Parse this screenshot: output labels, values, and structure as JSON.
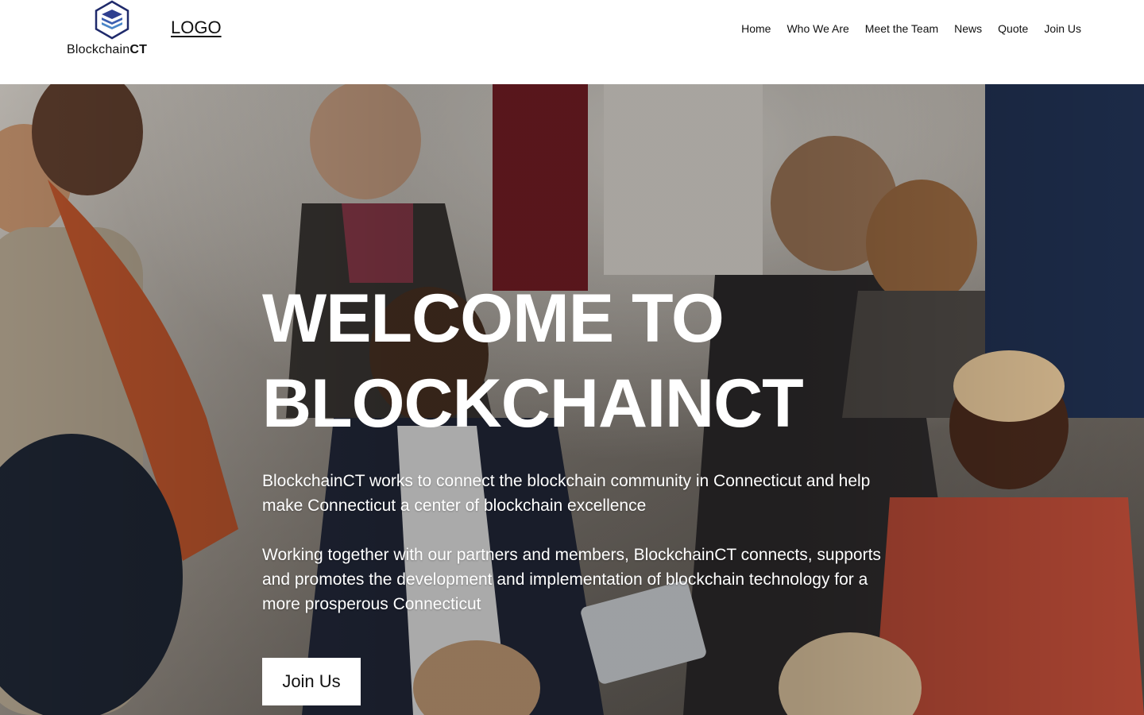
{
  "brand": {
    "name_regular": "Blockchain",
    "name_bold": "CT",
    "logo_link": "LOGO",
    "icon": "stacked-layers-hexagon-icon",
    "accent_color": "#1f2a6b"
  },
  "nav": {
    "items": [
      "Home",
      "Who We Are",
      "Meet the Team",
      "News",
      "Quote",
      "Join Us"
    ]
  },
  "hero": {
    "title_line1": "WELCOME TO",
    "title_line2": "BLOCKCHAINCT",
    "paragraph1": "BlockchainCT works to connect the blockchain community in Connecticut and help make Connecticut a center of blockchain excellence",
    "paragraph2": "Working together with our partners and members, BlockchainCT connects, supports and promotes the development and implementation of blockchain technology for a more prosperous Connecticut",
    "cta_label": "Join Us",
    "background": "networking-crowd-photo"
  }
}
